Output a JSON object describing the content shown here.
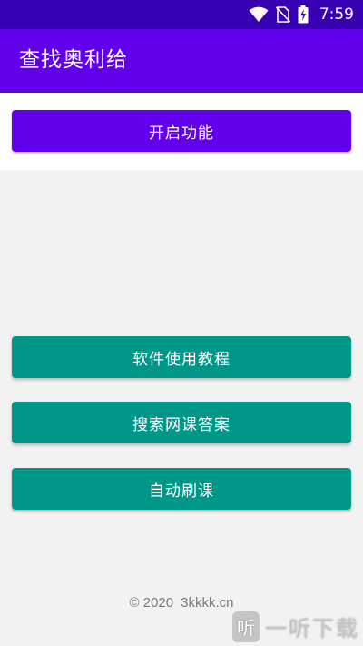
{
  "status_bar": {
    "time": "7:59",
    "icons": [
      "wifi-icon",
      "no-sim-icon",
      "battery-charging-icon"
    ]
  },
  "app_bar": {
    "title": "查找奥利给"
  },
  "buttons": {
    "enable_feature": "开启功能",
    "tutorial": "软件使用教程",
    "search_answers": "搜索网课答案",
    "auto_course": "自动刷课"
  },
  "footer": {
    "copyright": "© 2020",
    "site": "3kkkk.cn"
  },
  "watermark": {
    "logo_glyph": "听",
    "text": "一听下载"
  },
  "colors": {
    "status_bar": "#3700b3",
    "primary": "#6200ee",
    "teal": "#009688",
    "background": "#f2f2f2"
  }
}
